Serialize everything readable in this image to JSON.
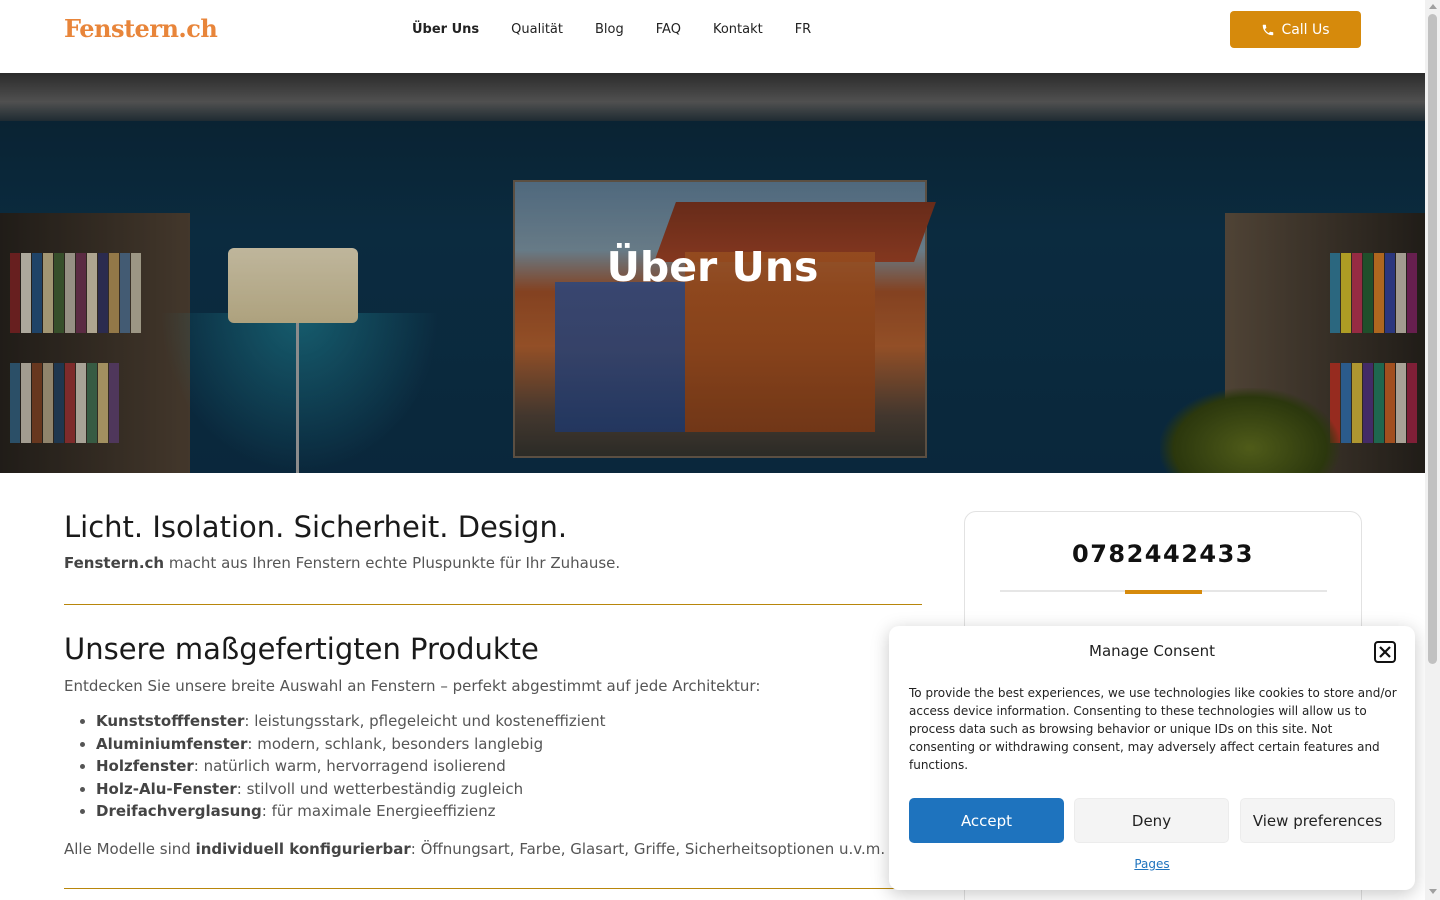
{
  "header": {
    "logo": "Fenstern.ch",
    "nav": [
      {
        "label": "Über Uns",
        "active": true
      },
      {
        "label": "Qualität"
      },
      {
        "label": "Blog"
      },
      {
        "label": "FAQ"
      },
      {
        "label": "Kontakt"
      },
      {
        "label": "FR"
      }
    ],
    "call_label": "Call Us",
    "call_icon": "phone-icon",
    "accent_color": "#d68a0c"
  },
  "hero": {
    "title": "Über Uns"
  },
  "main": {
    "heading": "Licht. Isolation. Sicherheit. Design.",
    "lead_brand": "Fenstern.ch",
    "lead_text": " macht aus Ihren Fenstern echte Pluspunkte für Ihr Zuhause.",
    "products_heading": "Unsere maßgefertigten Produkte",
    "products_intro": "Entdecken Sie unsere breite Auswahl an Fenstern – perfekt abgestimmt auf jede Architektur:",
    "products": [
      {
        "name": "Kunststofffenster",
        "desc": ": leistungsstark, pflegeleicht und kosteneffizient"
      },
      {
        "name": "Aluminiumfenster",
        "desc": ": modern, schlank, besonders langlebig"
      },
      {
        "name": "Holzfenster",
        "desc": ": natürlich warm, hervorragend isolierend"
      },
      {
        "name": "Holz-Alu-Fenster",
        "desc": ": stilvoll und wetterbeständig zugleich"
      },
      {
        "name": "Dreifachverglasung",
        "desc": ": für maximale Energieeffizienz"
      }
    ],
    "outro_pre": "Alle Modelle sind ",
    "outro_bold": "individuell konfigurierbar",
    "outro_post": ": Öffnungsart, Farbe, Glasart, Griffe, Sicherheitsoptionen u.v.m."
  },
  "sidebar": {
    "phone": "0782442433"
  },
  "consent": {
    "title": "Manage Consent",
    "text": "To provide the best experiences, we use technologies like cookies to store and/or access device information. Consenting to these technologies will allow us to process data such as browsing behavior or unique IDs on this site. Not consenting or withdrawing consent, may adversely affect certain features and functions.",
    "accept_label": "Accept",
    "deny_label": "Deny",
    "prefs_label": "View preferences",
    "pages_link": "Pages",
    "accept_color": "#1e73be"
  }
}
